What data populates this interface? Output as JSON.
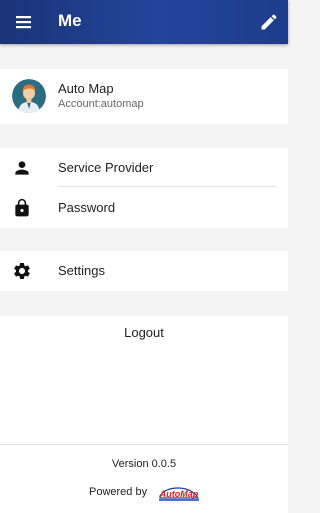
{
  "header": {
    "title": "Me",
    "menu_icon": "hamburger-menu-icon",
    "edit_icon": "pencil-icon"
  },
  "profile": {
    "name": "Auto Map",
    "account": "Account:automap"
  },
  "menu": {
    "service_provider": "Service Provider",
    "password": "Password",
    "settings": "Settings",
    "logout": "Logout"
  },
  "footer": {
    "version": "Version 0.0.5",
    "powered_by": "Powered by",
    "brand": "AutoMap"
  },
  "colors": {
    "appbar": "#1f3d8f",
    "brand_red": "#e02020",
    "brand_blue": "#1c3fb0"
  }
}
